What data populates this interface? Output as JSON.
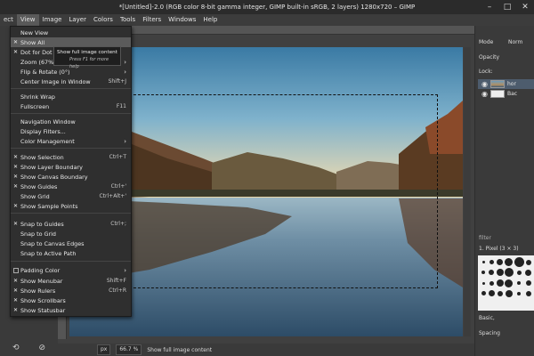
{
  "window": {
    "title": "*[Untitled]-2.0 (RGB color 8-bit gamma integer, GIMP built-in sRGB, 2 layers) 1280x720 – GIMP"
  },
  "menubar": {
    "items": [
      "ect",
      "View",
      "Image",
      "Layer",
      "Colors",
      "Tools",
      "Filters",
      "Windows",
      "Help"
    ],
    "active": "View"
  },
  "view_menu": {
    "items": [
      {
        "label": "New View",
        "check": "none"
      },
      {
        "label": "Show All",
        "check": "on",
        "highlight": true
      },
      {
        "label": "Dot for Dot",
        "check": "on"
      },
      {
        "label": "Zoom (67%)",
        "submenu": true
      },
      {
        "label": "Flip & Rotate (0°)",
        "submenu": true
      },
      {
        "label": "Center Image in Window",
        "accel": "Shift+J"
      },
      {
        "label": "Shrink Wrap"
      },
      {
        "label": "Fullscreen",
        "accel": "F11"
      },
      {
        "label": "Navigation Window"
      },
      {
        "label": "Display Filters..."
      },
      {
        "label": "Color Management",
        "submenu": true
      },
      {
        "label": "Show Selection",
        "check": "on",
        "accel": "Ctrl+T"
      },
      {
        "label": "Show Layer Boundary",
        "check": "on"
      },
      {
        "label": "Show Canvas Boundary",
        "check": "on"
      },
      {
        "label": "Show Guides",
        "check": "on",
        "accel": "Ctrl+'"
      },
      {
        "label": "Show Grid",
        "check": "off",
        "accel": "Ctrl+Alt+'"
      },
      {
        "label": "Show Sample Points",
        "check": "on"
      },
      {
        "label": "Snap to Guides",
        "check": "on",
        "accel": "Ctrl+;"
      },
      {
        "label": "Snap to Grid",
        "check": "off"
      },
      {
        "label": "Snap to Canvas Edges",
        "check": "off"
      },
      {
        "label": "Snap to Active Path",
        "check": "off"
      },
      {
        "label": "Padding Color",
        "check": "box",
        "submenu": true
      },
      {
        "label": "Show Menubar",
        "check": "on",
        "accel": "Shift+F"
      },
      {
        "label": "Show Rulers",
        "check": "on",
        "accel": "Ctrl+R"
      },
      {
        "label": "Show Scrollbars",
        "check": "on"
      },
      {
        "label": "Show Statusbar",
        "check": "on"
      }
    ]
  },
  "tooltip": {
    "text": "Show full image content",
    "help": "Press F1 for more help"
  },
  "statusbar": {
    "unit": "px",
    "zoom": "66.7 %",
    "message": "Show full image content"
  },
  "right_dock": {
    "mode_label": "Mode",
    "mode_value": "Norm",
    "opacity_label": "Opacity",
    "lock_label": "Lock:",
    "layers": [
      {
        "name": "hor",
        "thumb": "photo",
        "selected": true
      },
      {
        "name": "Bac",
        "thumb": "white",
        "selected": false
      }
    ],
    "filter_placeholder": "filter",
    "brush_name": "1. Pixel (3 × 3)",
    "brush_category": "Basic,",
    "spacing_label": "Spacing"
  },
  "colors": {
    "menu_bg": "#2f2f2f",
    "highlight": "#5b5b5b",
    "chrome": "#3a3a3a",
    "selection_layer": "#4d5c6d"
  }
}
